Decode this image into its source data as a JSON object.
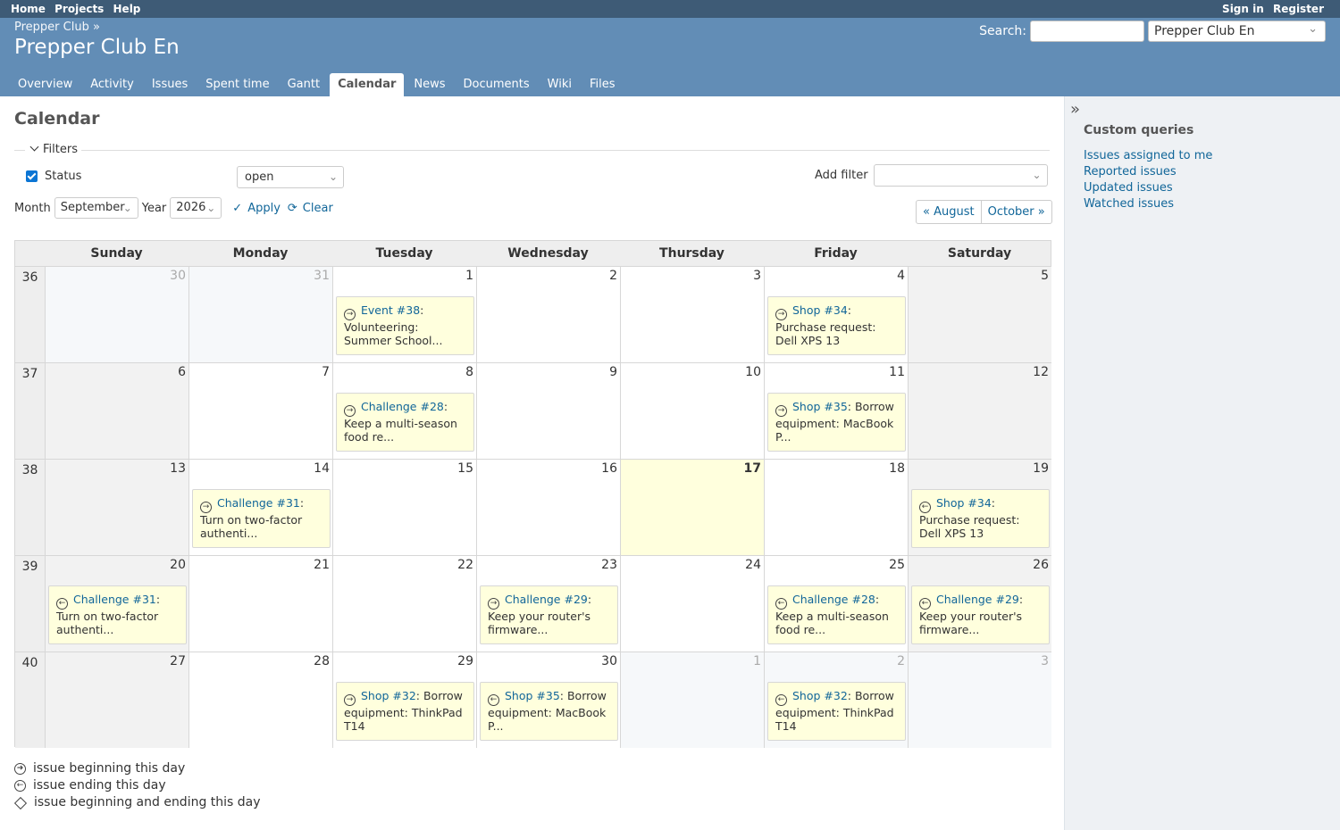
{
  "top_menu": {
    "left": [
      "Home",
      "Projects",
      "Help"
    ],
    "right": [
      "Sign in",
      "Register"
    ]
  },
  "header": {
    "breadcrumb": "Prepper Club »",
    "title": "Prepper Club En",
    "search_label": "Search:",
    "search_value": "",
    "project_jump": "Prepper Club En"
  },
  "tabs": [
    "Overview",
    "Activity",
    "Issues",
    "Spent time",
    "Gantt",
    "Calendar",
    "News",
    "Documents",
    "Wiki",
    "Files"
  ],
  "selected_tab": "Calendar",
  "page_title": "Calendar",
  "filters": {
    "legend": "Filters",
    "status_label": "Status",
    "status_operator": "open",
    "add_filter_label": "Add filter",
    "month_label": "Month",
    "month_value": "September",
    "year_label": "Year",
    "year_value": "2026",
    "apply": "Apply",
    "clear": "Clear"
  },
  "nav": {
    "prev": "« August",
    "next": "October »"
  },
  "calendar": {
    "weekdays": [
      "Sunday",
      "Monday",
      "Tuesday",
      "Wednesday",
      "Thursday",
      "Friday",
      "Saturday"
    ],
    "weeks": [
      {
        "num": "36",
        "days": [
          {
            "d": "30",
            "other": true
          },
          {
            "d": "31",
            "other": true
          },
          {
            "d": "1",
            "issue": {
              "type": "start",
              "link": "Event #38",
              "text": "Volunteering: Summer School..."
            }
          },
          {
            "d": "2"
          },
          {
            "d": "3"
          },
          {
            "d": "4",
            "issue": {
              "type": "start",
              "link": "Shop #34",
              "text": "Purchase request: Dell XPS 13"
            }
          },
          {
            "d": "5"
          }
        ]
      },
      {
        "num": "37",
        "days": [
          {
            "d": "6"
          },
          {
            "d": "7"
          },
          {
            "d": "8",
            "issue": {
              "type": "start",
              "link": "Challenge #28",
              "text": "Keep a multi-season food re..."
            }
          },
          {
            "d": "9"
          },
          {
            "d": "10"
          },
          {
            "d": "11",
            "issue": {
              "type": "start",
              "link": "Shop #35",
              "text": "Borrow equipment: MacBook P..."
            }
          },
          {
            "d": "12"
          }
        ]
      },
      {
        "num": "38",
        "days": [
          {
            "d": "13"
          },
          {
            "d": "14",
            "issue": {
              "type": "start",
              "link": "Challenge #31",
              "text": "Turn on two-factor authenti..."
            }
          },
          {
            "d": "15"
          },
          {
            "d": "16"
          },
          {
            "d": "17",
            "today": true
          },
          {
            "d": "18"
          },
          {
            "d": "19",
            "issue": {
              "type": "end",
              "link": "Shop #34",
              "text": "Purchase request: Dell XPS 13"
            }
          }
        ]
      },
      {
        "num": "39",
        "days": [
          {
            "d": "20",
            "issue": {
              "type": "end",
              "link": "Challenge #31",
              "text": "Turn on two-factor authenti..."
            }
          },
          {
            "d": "21"
          },
          {
            "d": "22"
          },
          {
            "d": "23",
            "issue": {
              "type": "start",
              "link": "Challenge #29",
              "text": "Keep your router's firmware..."
            }
          },
          {
            "d": "24"
          },
          {
            "d": "25",
            "issue": {
              "type": "end",
              "link": "Challenge #28",
              "text": "Keep a multi-season food re..."
            }
          },
          {
            "d": "26",
            "issue": {
              "type": "end",
              "link": "Challenge #29",
              "text": "Keep your router's firmware..."
            }
          }
        ]
      },
      {
        "num": "40",
        "days": [
          {
            "d": "27"
          },
          {
            "d": "28"
          },
          {
            "d": "29",
            "issue": {
              "type": "start",
              "link": "Shop #32",
              "text": "Borrow equipment: ThinkPad T14"
            }
          },
          {
            "d": "30",
            "issue": {
              "type": "end",
              "link": "Shop #35",
              "text": "Borrow equipment: MacBook P..."
            }
          },
          {
            "d": "1",
            "other": true
          },
          {
            "d": "2",
            "other": true,
            "issue": {
              "type": "end",
              "link": "Shop #32",
              "text": "Borrow equipment: ThinkPad T14"
            }
          },
          {
            "d": "3",
            "other": true
          }
        ]
      }
    ]
  },
  "legend": {
    "start": "issue beginning this day",
    "end": "issue ending this day",
    "both": "issue beginning and ending this day"
  },
  "sidebar": {
    "title": "Custom queries",
    "items": [
      "Issues assigned to me",
      "Reported issues",
      "Updated issues",
      "Watched issues"
    ]
  },
  "icons": {
    "start": "arrow-right-circle-icon",
    "end": "arrow-left-circle-icon",
    "both": "diamond-icon",
    "toggle": "double-chevron-right-icon"
  },
  "colors": {
    "top_bar": "#3E5B76",
    "header": "#628DB6",
    "link": "#116699",
    "issue_bg": "#FFFFDD",
    "today_bg": "#FFFFDD"
  }
}
